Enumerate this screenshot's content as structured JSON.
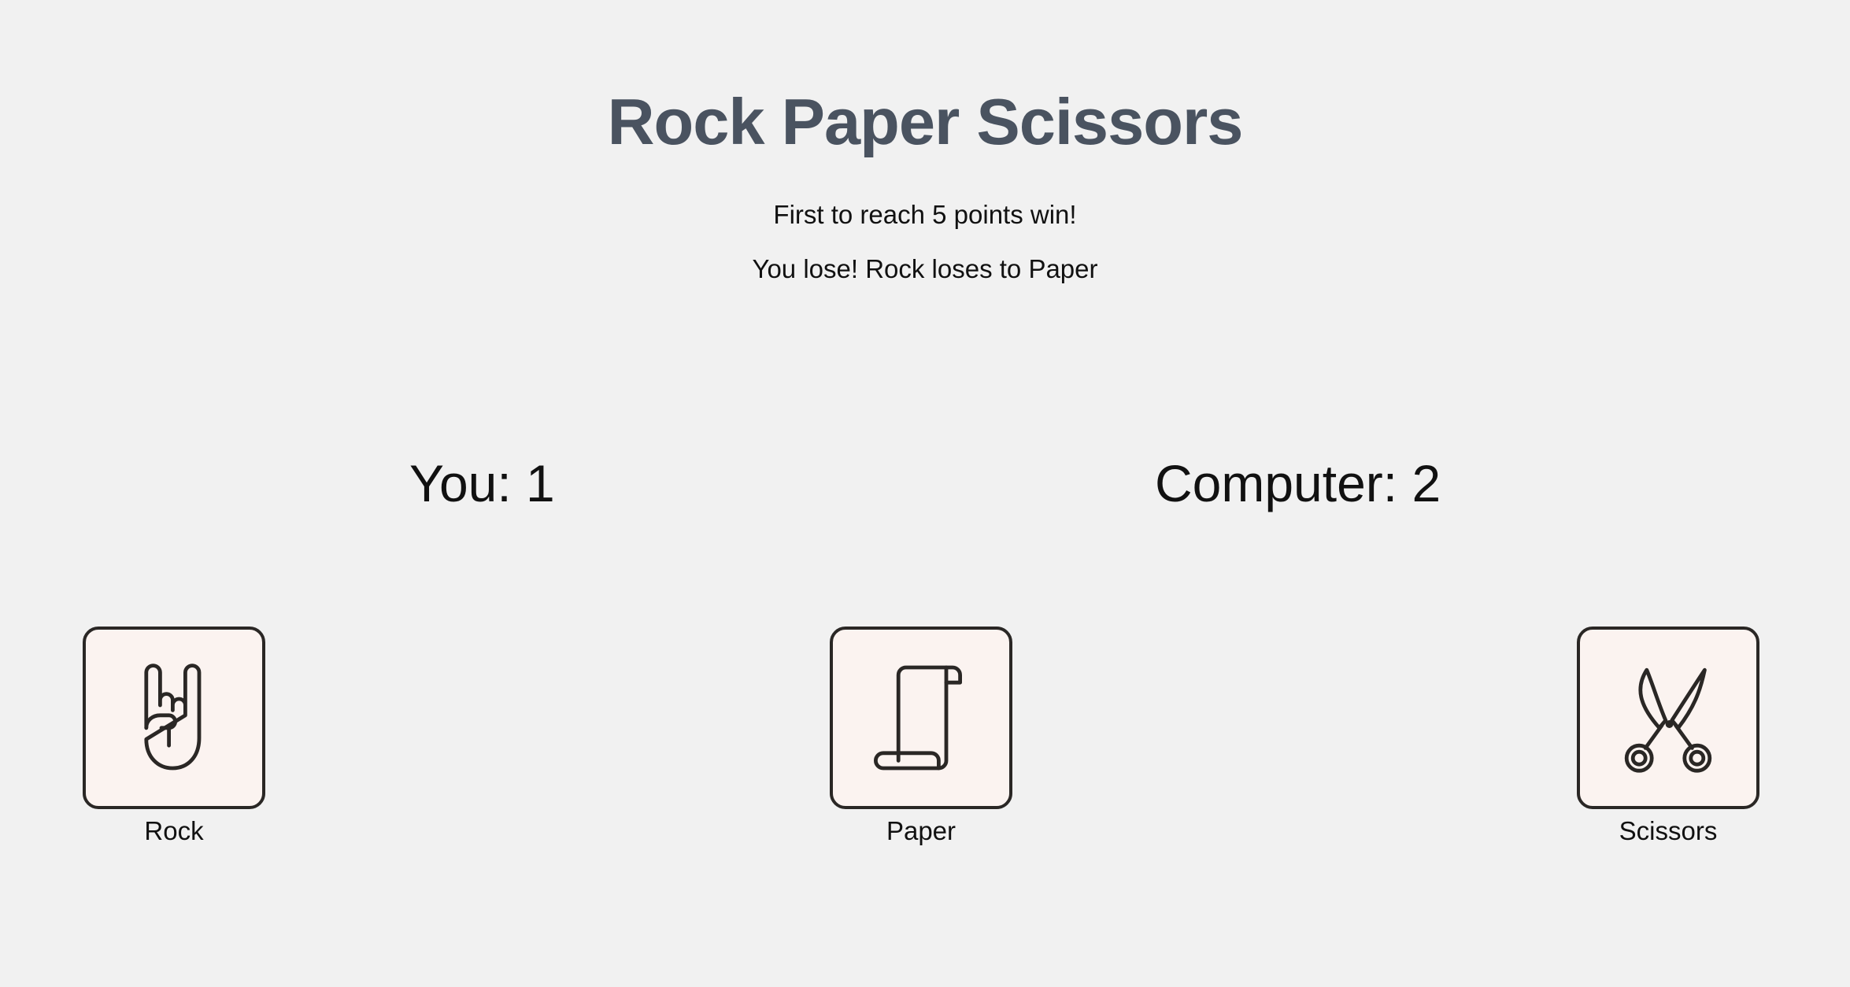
{
  "game": {
    "title": "Rock Paper Scissors",
    "rule": "First to reach 5 points win!",
    "result": "You lose! Rock loses to Paper"
  },
  "score": {
    "player_label": "You: 1",
    "computer_label": "Computer: 2"
  },
  "choices": [
    {
      "label": "Rock",
      "icon": "rock-hand-icon"
    },
    {
      "label": "Paper",
      "icon": "paper-scroll-icon"
    },
    {
      "label": "Scissors",
      "icon": "scissors-icon"
    }
  ],
  "colors": {
    "title": "#4a5360",
    "background": "#f1f1f1",
    "card_background": "#fbf3f0",
    "card_border": "#2a2725"
  }
}
